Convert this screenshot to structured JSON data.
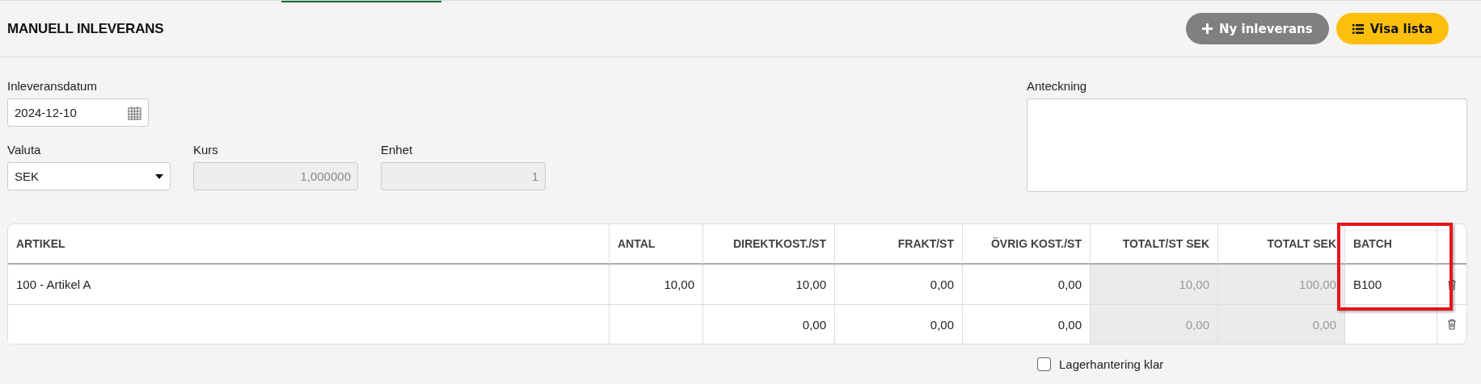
{
  "title": "MANUELL INLEVERANS",
  "buttons": [
    {
      "kind": "add",
      "label": "Ny inleverans"
    },
    {
      "kind": "list",
      "label": "Visa lista"
    }
  ],
  "form": {
    "date": {
      "label": "Inleveransdatum",
      "value": "2024-12-10"
    },
    "currency": {
      "label": "Valuta",
      "value": "SEK"
    },
    "rate": {
      "label": "Kurs",
      "value": "1,000000",
      "disabled": true
    },
    "unit": {
      "label": "Enhet",
      "value": "1",
      "disabled": true
    },
    "note": {
      "label": "Anteckning"
    }
  },
  "table": {
    "columns": [
      {
        "label": "ARTIKEL",
        "kind": "text",
        "readonly": false,
        "highlighted": false
      },
      {
        "label": "ANTAL",
        "kind": "quantity",
        "readonly": false,
        "highlighted": false
      },
      {
        "label": "DIREKTKOST./ST",
        "kind": "number",
        "readonly": false,
        "highlighted": false
      },
      {
        "label": "FRAKT/ST",
        "kind": "number",
        "readonly": false,
        "highlighted": false
      },
      {
        "label": "ÖVRIG KOST./ST",
        "kind": "number",
        "readonly": false,
        "highlighted": false
      },
      {
        "label": "TOTALT/ST SEK",
        "kind": "number",
        "readonly": true,
        "highlighted": false
      },
      {
        "label": "TOTALT SEK",
        "kind": "number",
        "readonly": true,
        "highlighted": false
      },
      {
        "label": "BATCH",
        "kind": "text",
        "readonly": false,
        "highlighted": true
      }
    ],
    "rows": [
      {
        "cells": [
          "100 - Artikel A",
          "10,00",
          "10,00",
          "0,00",
          "0,00",
          "10,00",
          "100,00",
          "B100"
        ]
      },
      {
        "cells": [
          null,
          null,
          "0,00",
          "0,00",
          "0,00",
          "0,00",
          "0,00",
          null
        ]
      }
    ]
  },
  "done_checkbox": {
    "label": "Lagerhantering klar",
    "checked": false
  }
}
